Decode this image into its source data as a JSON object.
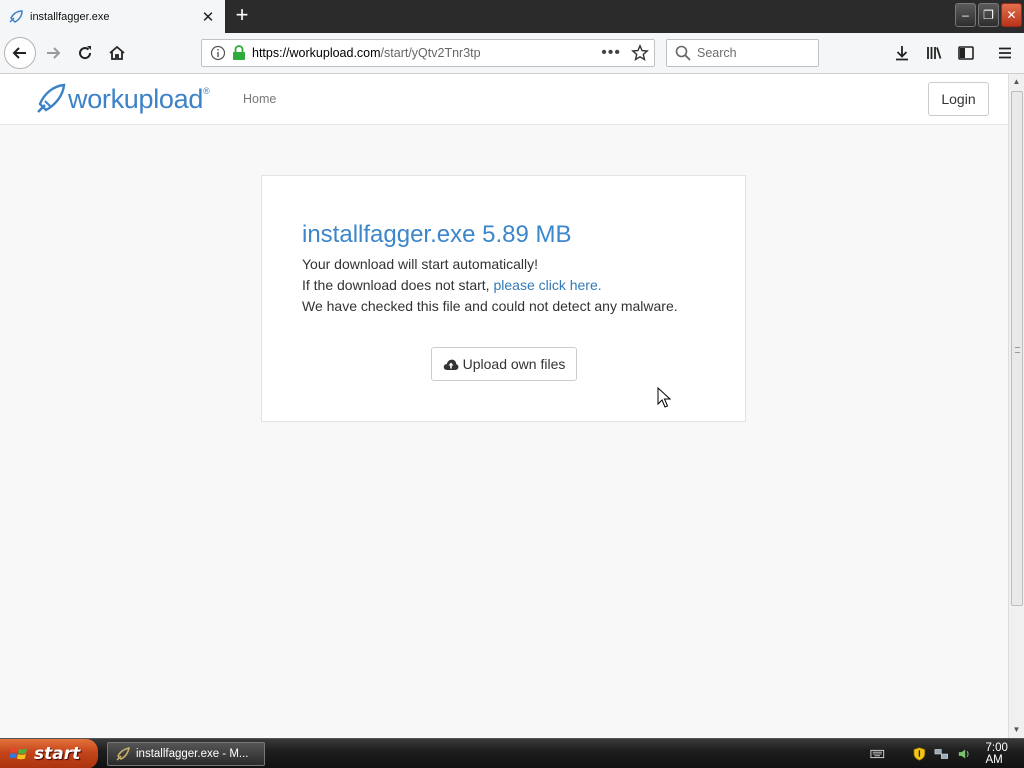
{
  "browser": {
    "tab_title": "installfagger.exe",
    "url_host": "https://workupload.com",
    "url_path": "/start/yQtv2Tnr3tp",
    "search_placeholder": "Search"
  },
  "site": {
    "logo_text": "workupload",
    "logo_reg": "®",
    "nav_home": "Home",
    "login_label": "Login"
  },
  "card": {
    "title": "installfagger.exe 5.89 MB",
    "line1": "Your download will start automatically!",
    "line2_prefix": "If the download does not start, ",
    "line2_link": "please click here.",
    "line3": "We have checked this file and could not detect any malware.",
    "upload_label": "Upload own files"
  },
  "taskbar": {
    "start_label": "start",
    "task_label": "installfagger.exe - M...",
    "clock": "7:00 AM"
  },
  "colors": {
    "accent": "#3c86cc",
    "link": "#337ab7",
    "start": "#c4441a"
  }
}
